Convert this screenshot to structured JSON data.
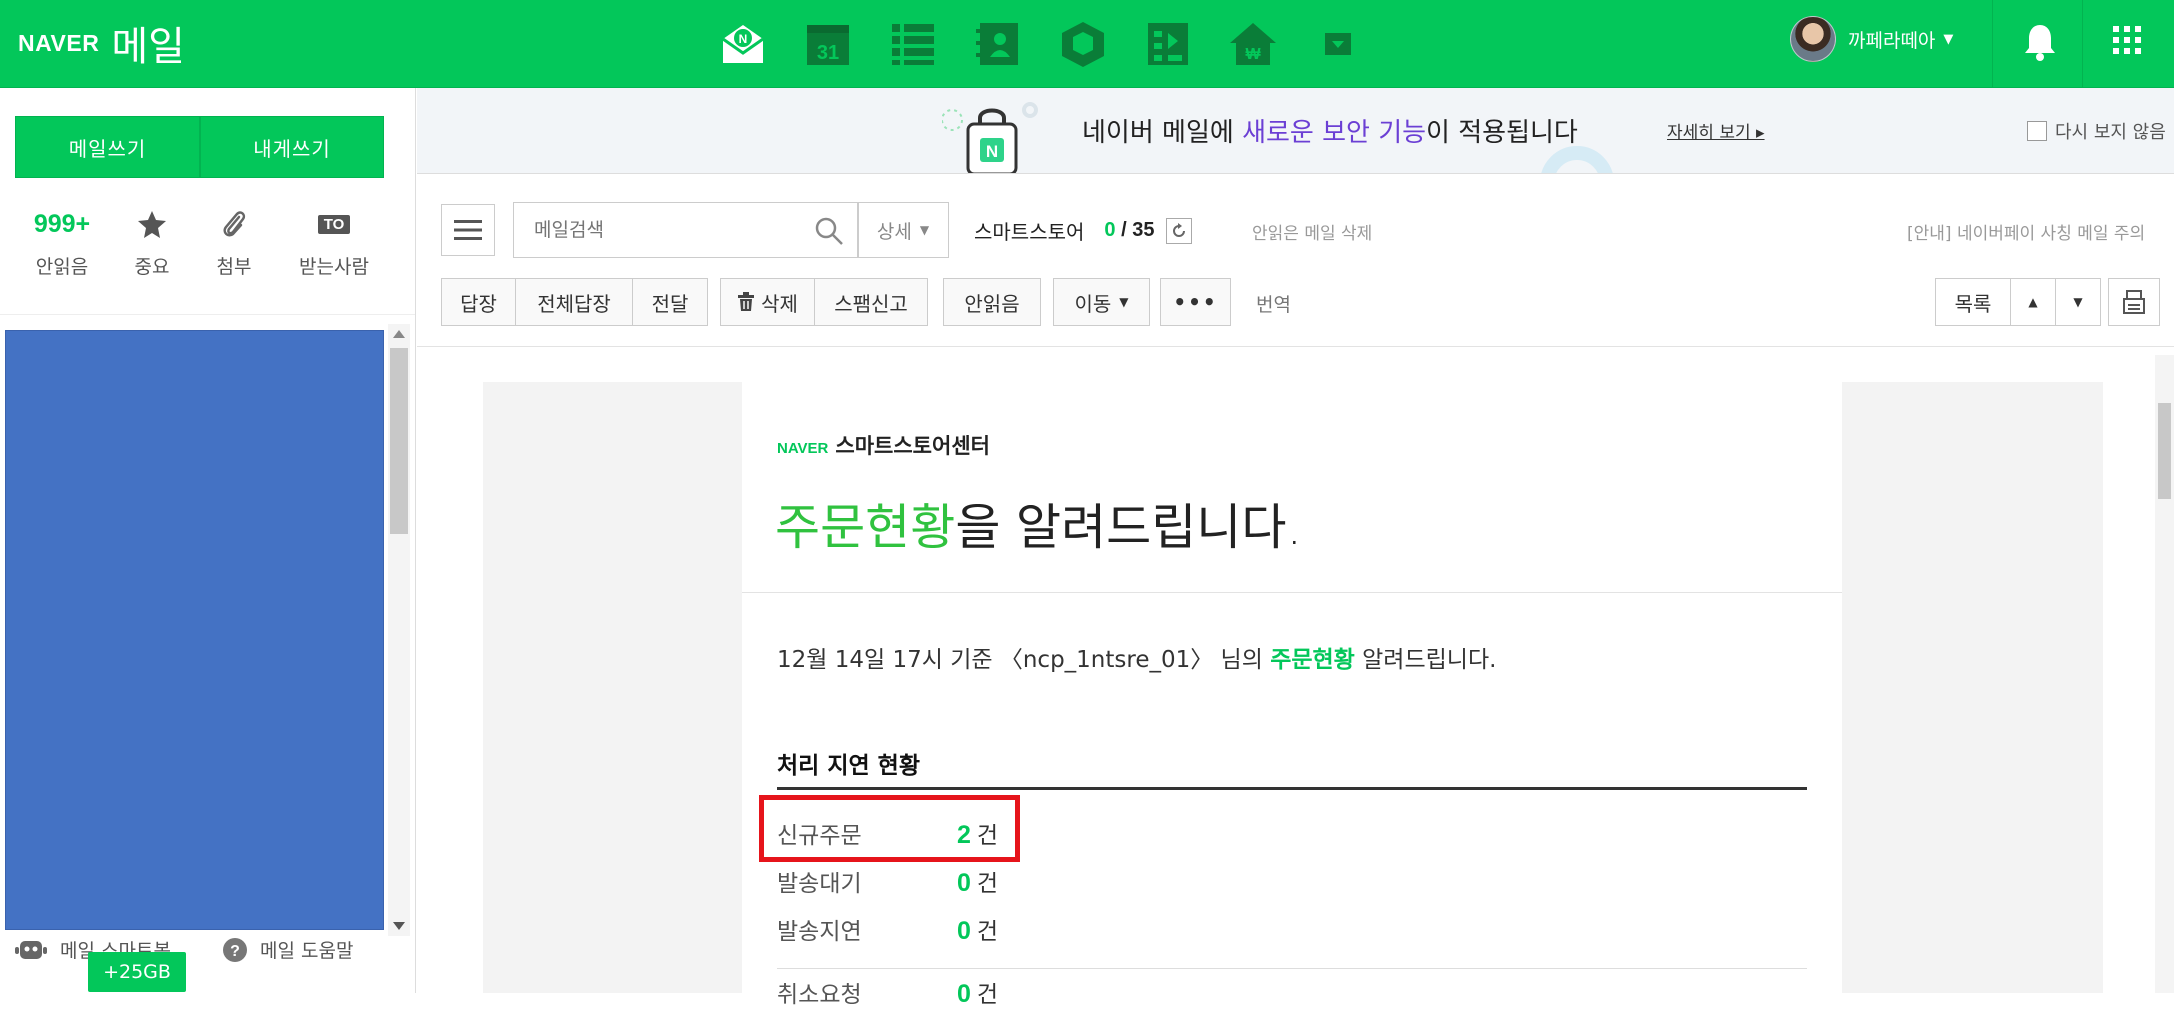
{
  "header": {
    "logo_naver": "NAVER",
    "logo_mail": "메일",
    "user_name": "까페라떼아",
    "apps": [
      "mail-app-icon",
      "calendar-app-icon",
      "list-app-icon",
      "contacts-app-icon",
      "box-app-icon",
      "media-app-icon",
      "house-app-icon",
      "more-app-icon"
    ],
    "calendar_day": "31",
    "accent": "#03c75a"
  },
  "sidebar": {
    "write_mail": "메일쓰기",
    "write_to_me": "내게쓰기",
    "unread_count": "999+",
    "unread_label": "안읽음",
    "important_label": "중요",
    "attach_label": "첨부",
    "to_badge": "TO",
    "recipient_label": "받는사람",
    "smartbot": "메일 스마트봇",
    "help": "메일 도움말",
    "storage_badge": "+25GB"
  },
  "banner": {
    "msg_before": "네이버 메일에 ",
    "msg_highlight": "새로운 보안 기능",
    "msg_after": "이 적용됩니다",
    "more": "자세히 보기 ▸",
    "dont_show": "다시 보지 않음"
  },
  "toolbar": {
    "search_placeholder": "메일검색",
    "detail": "상세",
    "store_name": "스마트스토어",
    "unread_num": "0",
    "total_num": "35",
    "delete_unread": "안읽은 메일 삭제",
    "notice": "[안내] 네이버페이 사칭 메일 주의",
    "reply": "답장",
    "reply_all": "전체답장",
    "forward": "전달",
    "delete": "삭제",
    "spam": "스팸신고",
    "mark_unread": "안읽음",
    "move": "이동",
    "more": "•••",
    "translate": "번역",
    "list": "목록"
  },
  "mail": {
    "brand_naver": "NAVER",
    "brand_center": "스마트스토어센터",
    "headline_green": "주문현황",
    "headline_rest": "을 알려드립니다.",
    "intro_before": "12월 14일 17시 기준 〈ncp_1ntsre_01〉 님의 ",
    "intro_green": "주문현황",
    "intro_after": " 알려드립니다.",
    "section_title": "처리 지연 현황",
    "rows": [
      {
        "label": "신규주문",
        "value": "2",
        "unit": "건"
      },
      {
        "label": "발송대기",
        "value": "0",
        "unit": "건"
      },
      {
        "label": "발송지연",
        "value": "0",
        "unit": "건"
      },
      {
        "label": "취소요청",
        "value": "0",
        "unit": "건"
      }
    ]
  }
}
